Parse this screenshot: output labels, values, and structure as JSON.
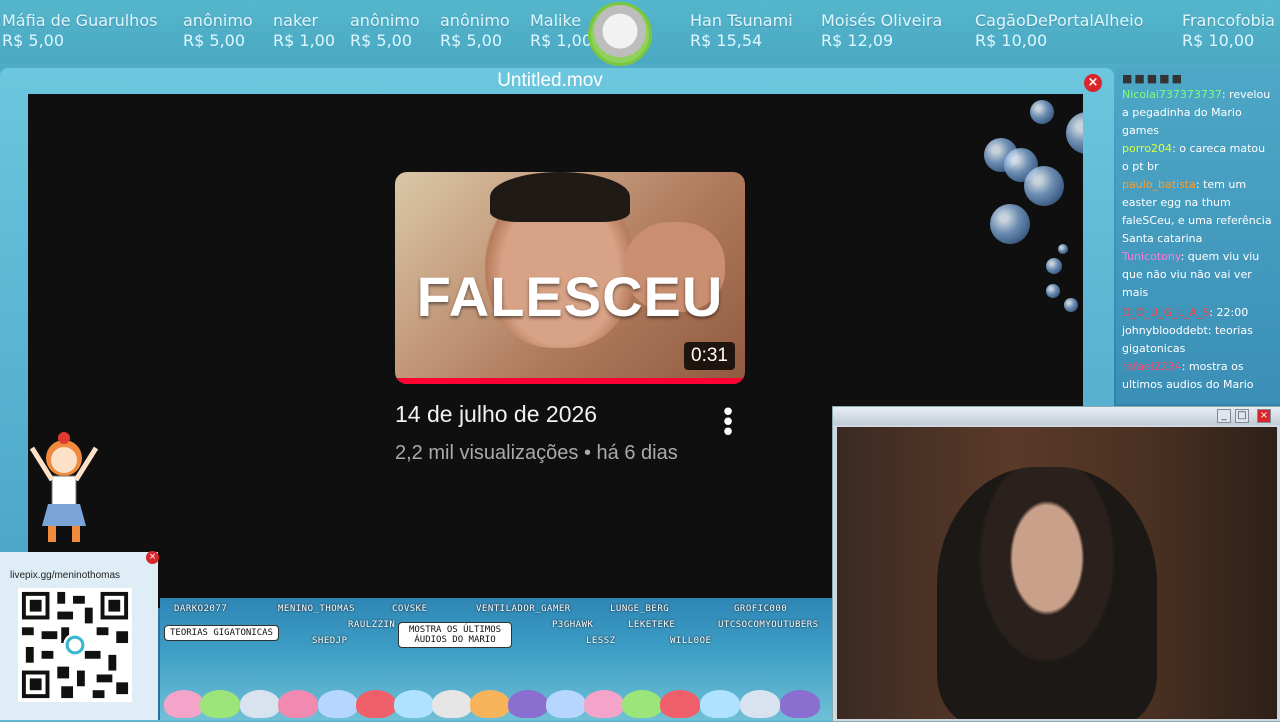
{
  "ticker": {
    "donations": [
      {
        "name": "Máfia de Guarulhos",
        "amount": "R$ 5,00"
      },
      {
        "name": "anônimo",
        "amount": "R$ 5,00"
      },
      {
        "name": "naker",
        "amount": "R$ 1,00"
      },
      {
        "name": "anônimo",
        "amount": "R$ 5,00"
      },
      {
        "name": "anônimo",
        "amount": "R$ 5,00"
      },
      {
        "name": "Malike",
        "amount": "R$ 1,00"
      },
      {
        "name": "Han Tsunami",
        "amount": "R$ 15,54"
      },
      {
        "name": "Moisés Oliveira",
        "amount": "R$ 12,09"
      },
      {
        "name": "CagãoDePortalAlheio",
        "amount": "R$ 10,00"
      },
      {
        "name": "Francofobia",
        "amount": "R$ 10,00"
      }
    ]
  },
  "player": {
    "title": "Untitled.mov",
    "close": "×",
    "video": {
      "thumb_text": "FALESCEU",
      "duration": "0:31",
      "title": "14 de julho de 2026",
      "meta": "2,2 mil visualizações • há 6 dias",
      "menu": "⋮"
    }
  },
  "chat": {
    "messages": [
      {
        "user": "Nicolai737373737",
        "text": "revelou a pegadinha do Mario games",
        "color": "#7dff7a"
      },
      {
        "user": "porro204",
        "text": "o careca matou o pt br",
        "color": "#d8ff3a"
      },
      {
        "user": "paulo_batista",
        "text": "tem um easter egg na thum faleSCeu, e uma referência Santa catarina",
        "color": "#ff9c2a"
      },
      {
        "user": "Tunicotony",
        "text": "quem viu viu que não viu não vai ver mais",
        "color": "#ff7ad8"
      },
      {
        "user": "D_O_U_G_L_A_S",
        "text": "22:00",
        "color": "#ff4040"
      },
      {
        "user": "johnyblooddebt",
        "text": "teorias gigatonicas",
        "color": "#ffffff"
      },
      {
        "user": "rafael2234",
        "text": "mostra os ultimos audios do Mario",
        "color": "#ff4a6a"
      }
    ]
  },
  "webcam": {
    "minimize": "_",
    "maximize": "□",
    "close": "×"
  },
  "livepix": {
    "url": "livepix.gg/meninothomas",
    "close": "×"
  },
  "overlay_names": {
    "row1": [
      "DARKO2077",
      "MENINO_THOMAS",
      "COVSKE",
      "VENTILADOR_GAMER",
      "LUNGE_BERG",
      "GROFIC000"
    ],
    "row2": [
      "RAULZZIN",
      "P3GHAWK",
      "LEKETEKE",
      "UTCSOCOMYOUTUBERS"
    ],
    "row3": [
      "SHEDJP",
      "LESSZ",
      "WILL0OE"
    ],
    "tag1": "TEORIAS GIGATONICAS",
    "tag2_line1": "MOSTRA OS ÚLTIMOS",
    "tag2_line2": "ÁUDIOS DO MARIO"
  },
  "colors": {
    "accent": "#d9262a",
    "chat_bg": "#4ea7c6",
    "progress": "#ff0033"
  }
}
